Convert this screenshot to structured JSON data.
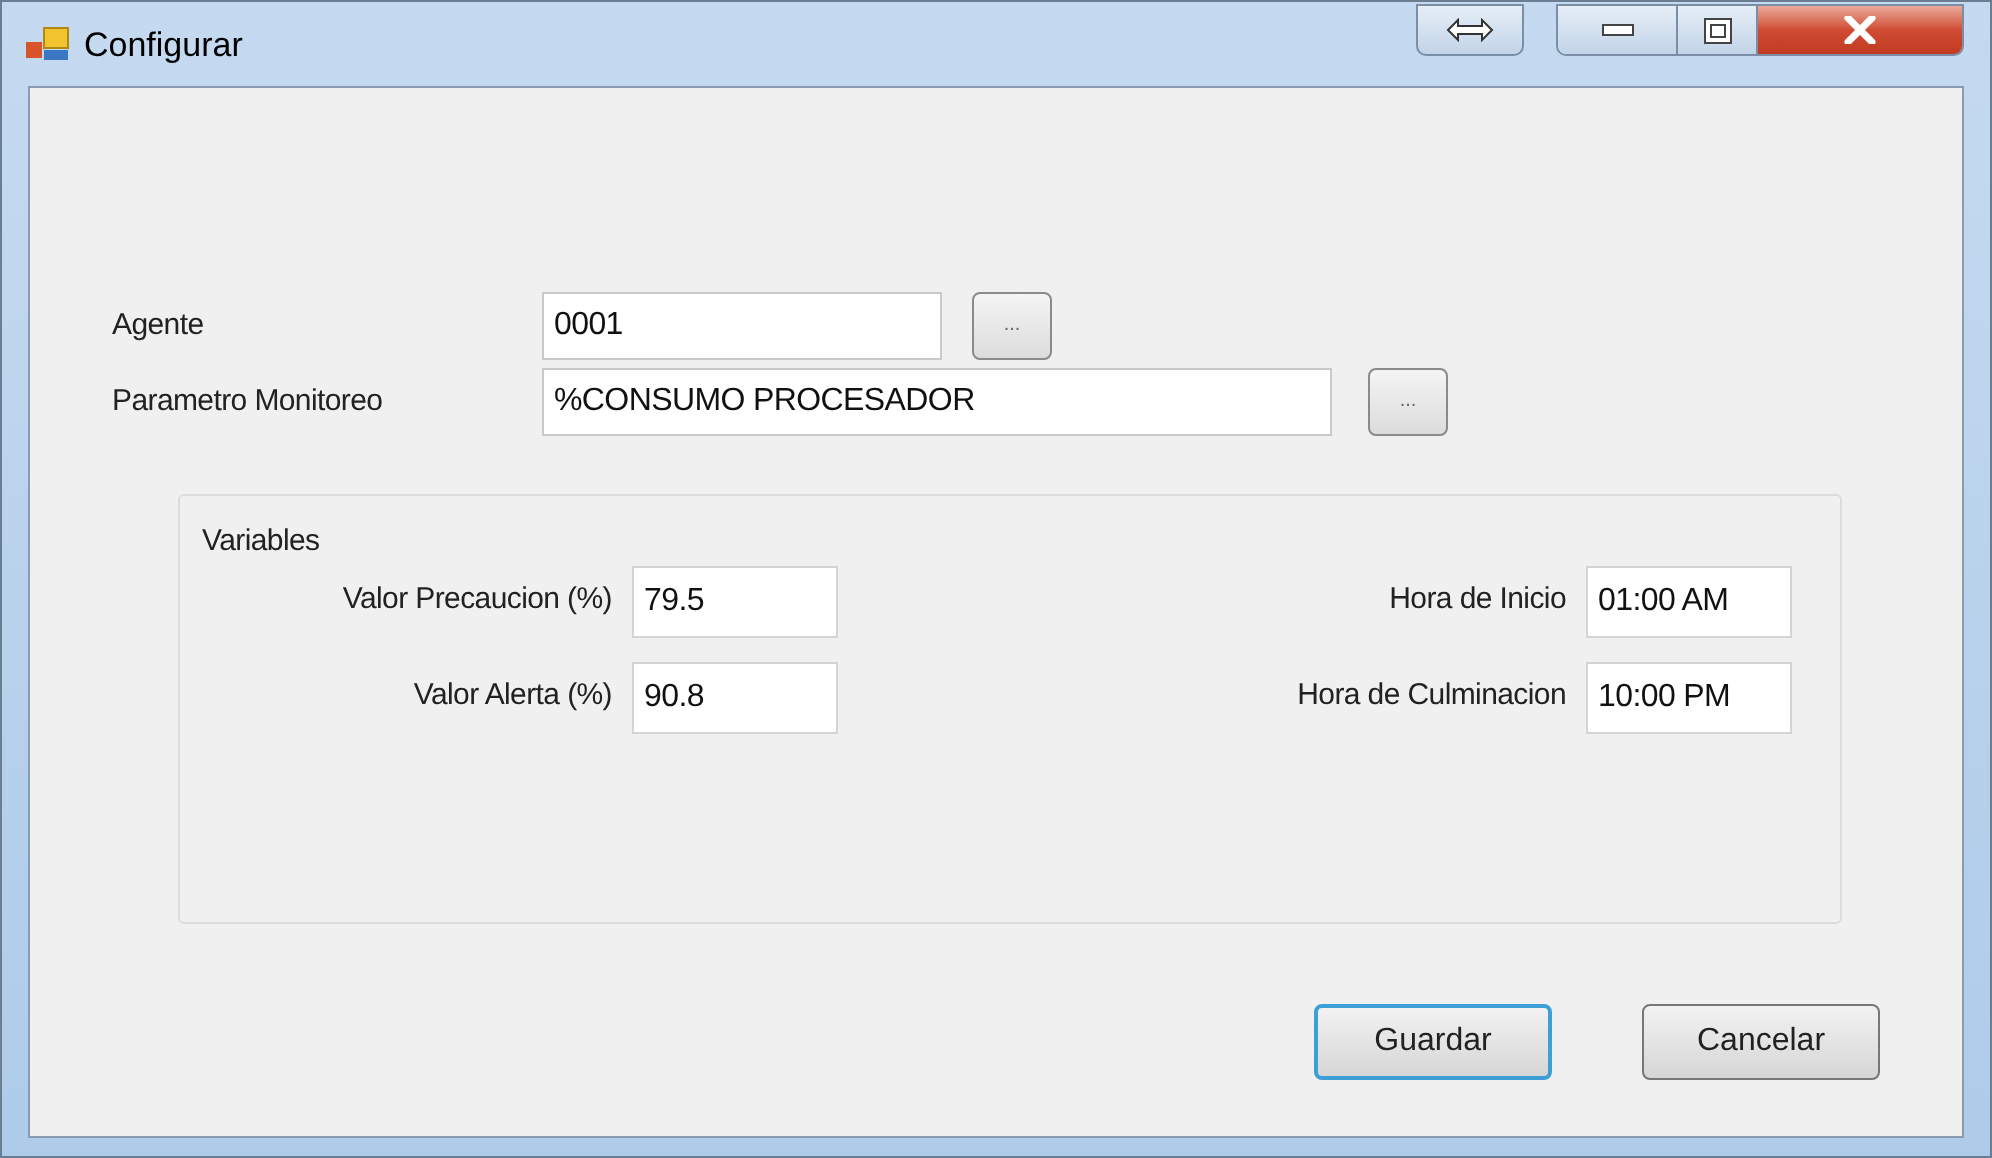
{
  "window": {
    "title": "Configurar"
  },
  "fields": [
    {
      "label": "Agente",
      "value": "0001",
      "browse": "..."
    },
    {
      "label": "Parametro Monitoreo",
      "value": "%CONSUMO PROCESADOR",
      "browse": "..."
    }
  ],
  "variables": {
    "title": "Variables",
    "left": [
      {
        "label": "Valor Precaucion (%)",
        "value": "79.5"
      },
      {
        "label": "Valor Alerta (%)",
        "value": "90.8"
      }
    ],
    "right": [
      {
        "label": "Hora de Inicio",
        "value": "01:00 AM"
      },
      {
        "label": "Hora de Culminacion",
        "value": "10:00 PM"
      }
    ]
  },
  "buttons": [
    {
      "label": "Guardar",
      "default": true
    },
    {
      "label": "Cancelar",
      "default": false
    }
  ]
}
